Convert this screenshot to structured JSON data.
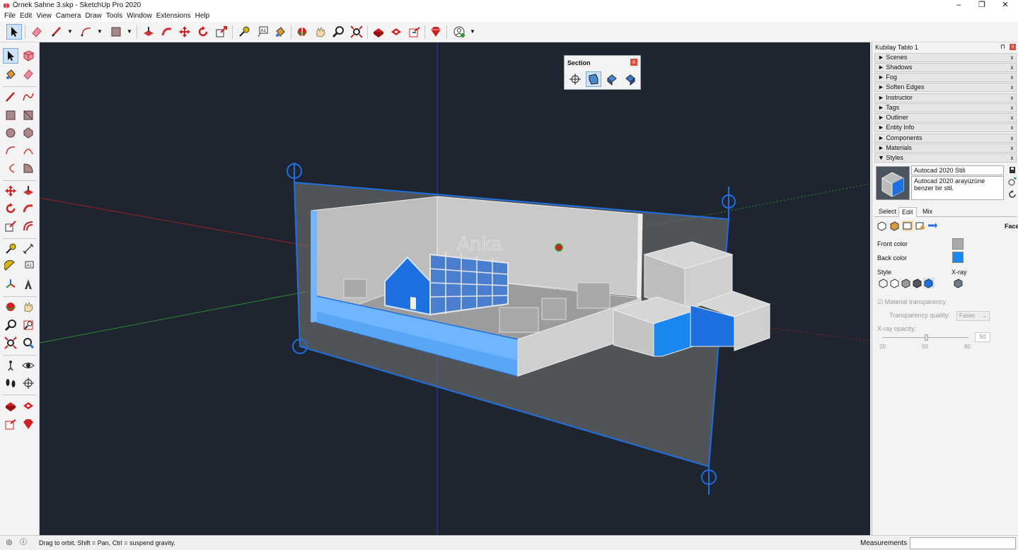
{
  "window": {
    "title": "Örnek Sahne 3.skp - SketchUp Pro 2020",
    "controls": {
      "minimize": "–",
      "maximize": "❐",
      "close": "✕"
    }
  },
  "menubar": [
    "File",
    "Edit",
    "View",
    "Camera",
    "Draw",
    "Tools",
    "Window",
    "Extensions",
    "Help"
  ],
  "toolbar": {
    "drop_arrow": "▼",
    "tools": [
      "select-icon",
      "eraser-icon",
      "pencil-icon",
      "arc-icon",
      "paint-bucket-icon",
      "push-pull-icon",
      "follow-me-icon",
      "move-icon",
      "rotate-icon",
      "scale-icon",
      "tape-measure-icon",
      "text-icon",
      "paint-icon",
      "orbit-icon",
      "pan-icon",
      "zoom-icon",
      "zoom-extents-icon",
      "warehouse-icon",
      "extension-icon",
      "send-icon",
      "ruby-icon",
      "account-icon"
    ]
  },
  "section_toolbar": {
    "title": "Section",
    "close": "x"
  },
  "viewport": {
    "signage_text": "Anka",
    "accent": "#1e6fe0",
    "background": "#1e2530"
  },
  "tray": {
    "title": "Kubilay Tablo 1",
    "pin": "⊓",
    "close": "x",
    "panels": [
      {
        "label": "► Scenes"
      },
      {
        "label": "► Shadows"
      },
      {
        "label": "► Fog"
      },
      {
        "label": "► Soften Edges"
      },
      {
        "label": "► Instructor"
      },
      {
        "label": "► Tags"
      },
      {
        "label": "► Outliner"
      },
      {
        "label": "► Entity Info"
      },
      {
        "label": "► Components"
      },
      {
        "label": "► Materials"
      },
      {
        "label": "▼ Styles"
      }
    ],
    "panel_close": "x",
    "styles": {
      "name": "Autocad 2020 Stili",
      "description": "Autocad 2020 arayüzüne benzer bir stil.",
      "tabs": [
        "Select",
        "Edit",
        "Mix"
      ],
      "active_tab": "Edit",
      "face_label": "Face",
      "front_color_label": "Front color",
      "front_color": "#a9a9a9",
      "back_color_label": "Back color",
      "back_color": "#1a86f0",
      "style_label": "Style",
      "xray_label": "X-ray",
      "material_transparency_label": "Material transparency",
      "checkbox": "☑",
      "transparency_quality_label": "Transparency quality:",
      "transparency_quality_value": "Faster",
      "xray_opacity_label": "X-ray opacity:",
      "xray_opacity_value": "50",
      "slider_ticks": [
        "20",
        "50",
        "80"
      ]
    }
  },
  "statusbar": {
    "hint": "Drag to orbit. Shift = Pan, Ctrl = suspend gravity.",
    "measurements_label": "Measurements",
    "icon_geo": "◎",
    "icon_info": "ⓘ"
  }
}
